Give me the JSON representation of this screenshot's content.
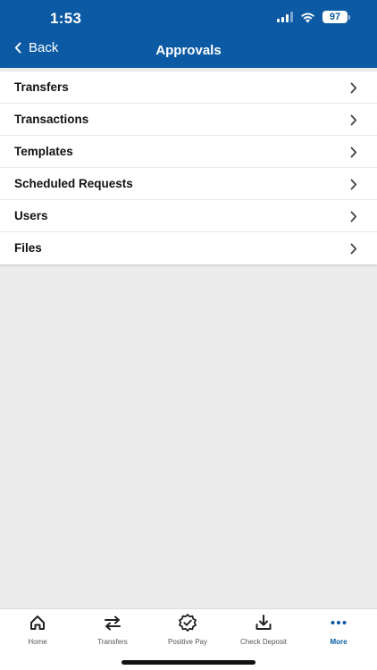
{
  "colors": {
    "brand": "#0b5aa3",
    "background": "#ececec",
    "active_tab": "#0b5aa3"
  },
  "status_bar": {
    "time": "1:53",
    "battery": "97",
    "icons": [
      "signal-icon",
      "wifi-icon",
      "battery-icon"
    ]
  },
  "nav": {
    "back_label": "Back",
    "title": "Approvals"
  },
  "list": {
    "items": [
      {
        "label": "Transfers"
      },
      {
        "label": "Transactions"
      },
      {
        "label": "Templates"
      },
      {
        "label": "Scheduled Requests"
      },
      {
        "label": "Users"
      },
      {
        "label": "Files"
      }
    ]
  },
  "tabbar": {
    "tabs": [
      {
        "label": "Home",
        "icon": "home-icon"
      },
      {
        "label": "Transfers",
        "icon": "transfer-arrows-icon"
      },
      {
        "label": "Positive Pay",
        "icon": "badge-check-icon"
      },
      {
        "label": "Check Deposit",
        "icon": "download-tray-icon"
      },
      {
        "label": "More",
        "icon": "more-dots-icon",
        "active": true
      }
    ]
  }
}
